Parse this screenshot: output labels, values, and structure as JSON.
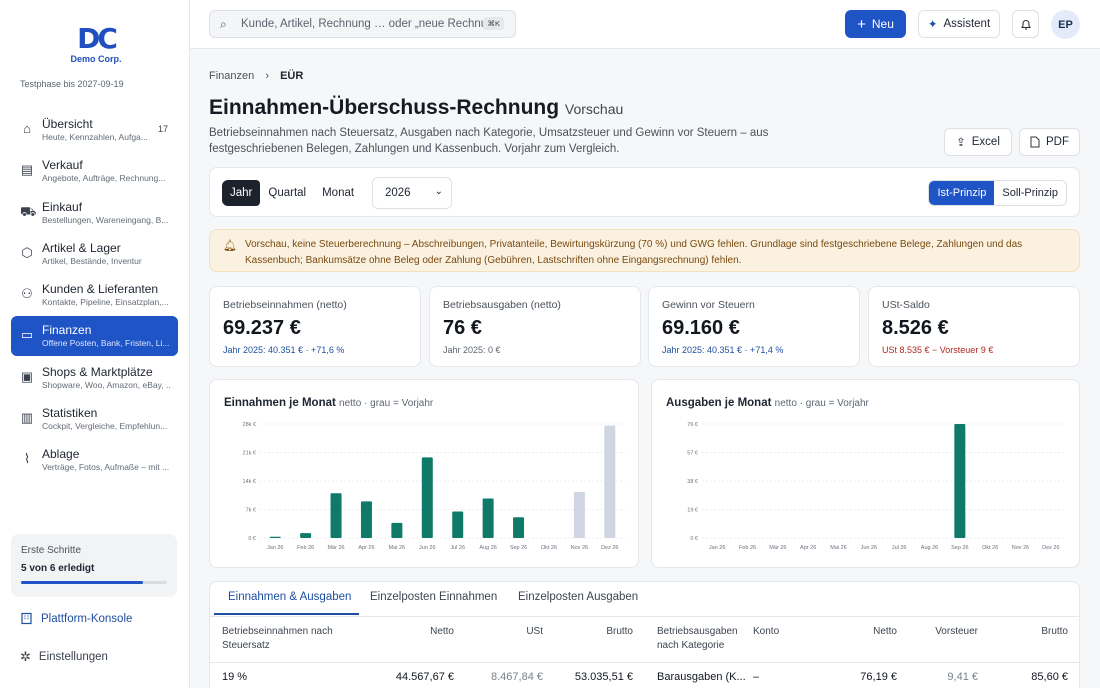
{
  "brand": {
    "logo_text": "DC",
    "logo_sub": "Demo Corp.",
    "trial": "Testphase bis 2027-09-19"
  },
  "nav": [
    {
      "label": "Übersicht",
      "sub": "Heute, Kennzahlen, Aufga...",
      "badge": "17",
      "icon": "home-icon"
    },
    {
      "label": "Verkauf",
      "sub": "Angebote, Aufträge, Rechnung...",
      "icon": "receipt-icon"
    },
    {
      "label": "Einkauf",
      "sub": "Bestellungen, Wareneingang, B...",
      "icon": "cart-icon"
    },
    {
      "label": "Artikel & Lager",
      "sub": "Artikel, Bestände, Inventur",
      "icon": "box-icon"
    },
    {
      "label": "Kunden & Lieferanten",
      "sub": "Kontakte, Pipeline, Einsatzplan,...",
      "icon": "users-icon"
    },
    {
      "label": "Finanzen",
      "sub": "Offene Posten, Bank, Fristen, Li...",
      "icon": "money-icon",
      "active": true
    },
    {
      "label": "Shops & Marktplätze",
      "sub": "Shopware, Woo, Amazon, eBay, ...",
      "icon": "shop-icon"
    },
    {
      "label": "Statistiken",
      "sub": "Cockpit, Vergleiche, Empfehlun...",
      "icon": "chart-icon"
    },
    {
      "label": "Ablage",
      "sub": "Verträge, Fotos, Aufmaße – mit ...",
      "icon": "paperclip-icon"
    }
  ],
  "steps": {
    "title": "Erste Schritte",
    "progress_text": "5 von 6 erledigt",
    "progress": 0.833
  },
  "side_links": {
    "console": "Plattform-Konsole",
    "settings": "Einstellungen"
  },
  "topbar": {
    "search_placeholder": "Kunde, Artikel, Rechnung … oder „neue Rechnu...",
    "kbd": "⌘K",
    "new": "Neu",
    "assistant": "Assistent",
    "avatar": "EP"
  },
  "page": {
    "breadcrumb": [
      "Finanzen",
      "EÜR"
    ],
    "title": "Einnahmen-Überschuss-Rechnung",
    "title_tag": "Vorschau",
    "subtitle": "Betriebseinnahmen nach Steuersatz, Ausgaben nach Kategorie, Umsatzsteuer und Gewinn vor Steuern – aus festgeschriebenen Belegen, Zahlungen und Kassenbuch. Vorjahr zum Vergleich.",
    "excel": "Excel",
    "pdf": "PDF"
  },
  "toolbar": {
    "periods": [
      "Jahr",
      "Quartal",
      "Monat"
    ],
    "year": "2026",
    "principles": [
      "Ist-Prinzip",
      "Soll-Prinzip"
    ]
  },
  "warning": "Vorschau, keine Steuerberechnung – Abschreibungen, Privatanteile, Bewirtungskürzung (70 %) und GWG fehlen. Grundlage sind festgeschriebene Belege, Zahlungen und das Kassenbuch; Bankumsätze ohne Beleg oder Zahlung (Gebühren, Lastschriften ohne Eingangsrechnung) fehlen.",
  "kpis": [
    {
      "label": "Betriebseinnahmen (netto)",
      "value": "69.237 €",
      "delta": "Jahr 2025: 40.351 € · +71,6 %",
      "tone": "blue"
    },
    {
      "label": "Betriebsausgaben (netto)",
      "value": "76 €",
      "delta": "Jahr 2025: 0 €",
      "tone": "grey"
    },
    {
      "label": "Gewinn vor Steuern",
      "value": "69.160 €",
      "delta": "Jahr 2025: 40.351 € · +71,4 %",
      "tone": "blue"
    },
    {
      "label": "USt-Saldo",
      "value": "8.526 €",
      "delta": "USt 8.535 € − Vorsteuer 9 €",
      "tone": "red"
    }
  ],
  "chart_data": [
    {
      "type": "bar",
      "title": "Einnahmen je Monat",
      "note": "netto · grau = Vorjahr",
      "categories": [
        "Jan 26",
        "Feb 26",
        "Mär 26",
        "Apr 26",
        "Mai 26",
        "Jun 26",
        "Jul 26",
        "Aug 26",
        "Sep 26",
        "Okt 26",
        "Nov 26",
        "Dez 26"
      ],
      "yticks": [
        "0 €",
        "7k €",
        "14k €",
        "21k €",
        "28k €"
      ],
      "ylim": [
        0,
        28000
      ],
      "series": [
        {
          "role": "current",
          "color": "#0f7a68",
          "values": [
            300,
            1200,
            11000,
            9000,
            3700,
            19800,
            6500,
            9700,
            5100,
            0,
            0,
            0
          ]
        },
        {
          "role": "previous",
          "color": "#cfd5e1",
          "values": [
            0,
            0,
            0,
            0,
            0,
            0,
            0,
            0,
            0,
            0,
            11300,
            27600
          ]
        }
      ]
    },
    {
      "type": "bar",
      "title": "Ausgaben je Monat",
      "note": "netto · grau = Vorjahr",
      "categories": [
        "Jan 26",
        "Feb 26",
        "Mär 26",
        "Apr 26",
        "Mai 26",
        "Jun 26",
        "Jul 26",
        "Aug 26",
        "Sep 26",
        "Okt 26",
        "Nov 26",
        "Dez 26"
      ],
      "yticks": [
        "0 €",
        "19 €",
        "38 €",
        "57 €",
        "76 €"
      ],
      "ylim": [
        0,
        76
      ],
      "series": [
        {
          "role": "current",
          "color": "#0f7a68",
          "values": [
            0,
            0,
            0,
            0,
            0,
            0,
            0,
            0,
            76,
            0,
            0,
            0
          ]
        },
        {
          "role": "previous",
          "color": "#cfd5e1",
          "values": [
            0,
            0,
            0,
            0,
            0,
            0,
            0,
            0,
            0,
            0,
            0,
            0
          ]
        }
      ]
    }
  ],
  "tabs": [
    "Einnahmen & Ausgaben",
    "Einzelposten Einnahmen",
    "Einzelposten Ausgaben"
  ],
  "income_table": {
    "headers": [
      "Betriebseinnahmen nach Steuersatz",
      "Netto",
      "USt",
      "Brutto"
    ],
    "rows": [
      [
        "19 %",
        "44.567,67 €",
        "8.467,84 €",
        "53.035,51 €"
      ]
    ]
  },
  "expense_table": {
    "headers": [
      "Betriebsausgaben nach Kategorie",
      "Konto",
      "Netto",
      "Vorsteuer",
      "Brutto"
    ],
    "rows": [
      [
        "Barausgaben (K...",
        "–",
        "76,19 €",
        "9,41 €",
        "85,60 €"
      ]
    ]
  }
}
